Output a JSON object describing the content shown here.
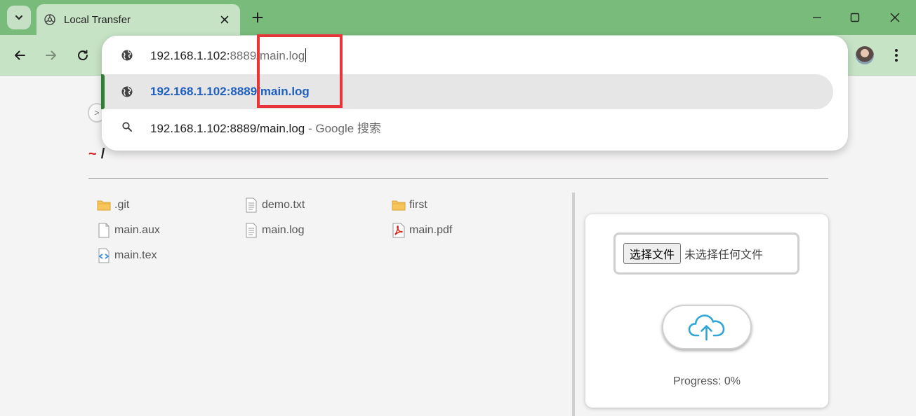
{
  "browser": {
    "tab_title": "Local Transfer",
    "address": {
      "typed": "192.168.1.102:",
      "faded_mid": "8889",
      "typed_end": "/main.log"
    },
    "suggestions": [
      {
        "text": "192.168.1.102:8889/main.log",
        "suffix": "",
        "icon": "globe-icon",
        "selected": true
      },
      {
        "text": "192.168.1.102:8889/main.log",
        "suffix": " - Google 搜索",
        "icon": "search-icon",
        "selected": false
      }
    ],
    "colors": {
      "tabbar": "#79bb7a",
      "toolbar": "#c7e3c6",
      "selected_text": "#1f5fbf",
      "accent": "#2e7d32",
      "highlight": "#e8353a"
    }
  },
  "page": {
    "back_chip": ">",
    "breadcrumb": {
      "home": "~",
      "sep": "/"
    },
    "files": [
      {
        "name": ".git",
        "icon": "folder-icon"
      },
      {
        "name": "demo.txt",
        "icon": "text-file-icon"
      },
      {
        "name": "first",
        "icon": "folder-icon"
      },
      {
        "name": "main.aux",
        "icon": "blank-file-icon"
      },
      {
        "name": "main.log",
        "icon": "text-file-icon"
      },
      {
        "name": "main.pdf",
        "icon": "pdf-file-icon"
      },
      {
        "name": "main.tex",
        "icon": "code-file-icon"
      }
    ],
    "upload": {
      "choose_label": "选择文件",
      "no_file_label": "未选择任何文件",
      "progress_label": "Progress: 0%",
      "progress_value": 0
    }
  }
}
